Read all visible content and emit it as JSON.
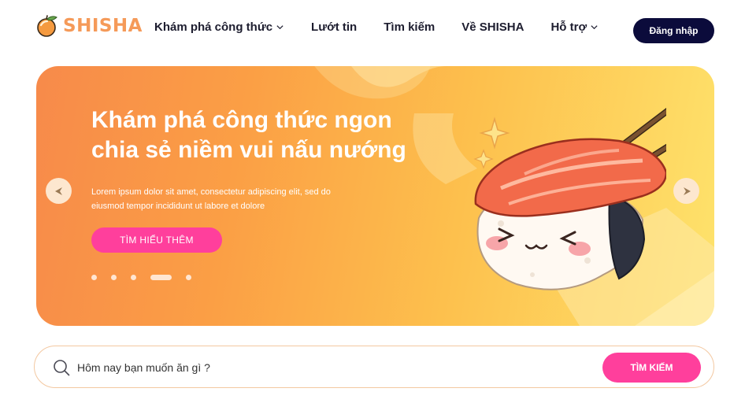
{
  "brand": {
    "name": "SHISHA",
    "accent": "#f59a59"
  },
  "nav": {
    "items": [
      {
        "label": "Khám phá công thức",
        "has_dropdown": true
      },
      {
        "label": "Lướt tin",
        "has_dropdown": false
      },
      {
        "label": "Tìm kiếm",
        "has_dropdown": false
      },
      {
        "label": "Về SHISHA",
        "has_dropdown": false
      },
      {
        "label": "Hỗ trợ",
        "has_dropdown": true
      }
    ],
    "login_label": "Đăng nhập"
  },
  "hero": {
    "title": "Khám phá công thức ngon chia sẻ niềm vui nấu nướng",
    "description": "Lorem ipsum dolor sit amet, consectetur adipiscing elit, sed do eiusmod tempor incididunt ut labore et dolore",
    "cta_label": "TÌM HIỂU THÊM",
    "slide_count": 5,
    "active_slide": 4,
    "icons": {
      "prev": "chevron-left-icon",
      "next": "chevron-right-icon",
      "image": "sushi-illustration"
    }
  },
  "search": {
    "placeholder": "Hôm nay bạn muốn ăn gì ?",
    "button_label": "TÌM KIẾM",
    "icon": "search-icon"
  },
  "colors": {
    "primary_pink": "#ff3f9c",
    "navy": "#0b0b3b",
    "hero_start": "#f78a4a",
    "hero_end": "#fee36c"
  }
}
